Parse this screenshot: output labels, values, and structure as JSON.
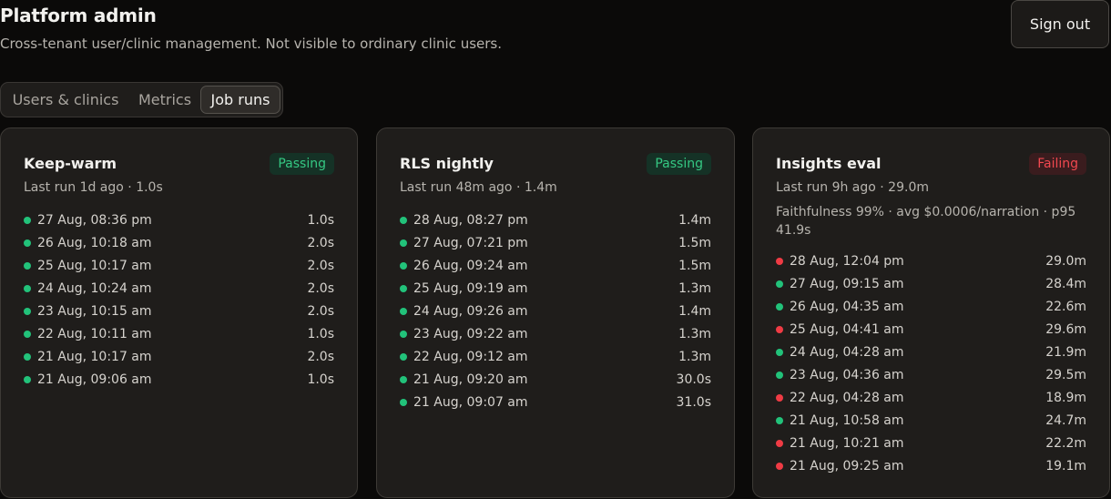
{
  "header": {
    "title": "Platform admin",
    "subtitle": "Cross-tenant user/clinic management. Not visible to ordinary clinic users.",
    "sign_out_label": "Sign out"
  },
  "tabs": [
    {
      "label": "Users & clinics",
      "active": false
    },
    {
      "label": "Metrics",
      "active": false
    },
    {
      "label": "Job runs",
      "active": true
    }
  ],
  "colors": {
    "pass_dot": "#22c27a",
    "fail_dot": "#ef3b44"
  },
  "jobs": [
    {
      "name": "Keep-warm",
      "status": "Passing",
      "status_kind": "pass",
      "last_run": "Last run 1d ago · 1.0s",
      "runs": [
        {
          "time": "27 Aug, 08:36 pm",
          "duration": "1.0s",
          "status": "pass"
        },
        {
          "time": "26 Aug, 10:18 am",
          "duration": "2.0s",
          "status": "pass"
        },
        {
          "time": "25 Aug, 10:17 am",
          "duration": "2.0s",
          "status": "pass"
        },
        {
          "time": "24 Aug, 10:24 am",
          "duration": "2.0s",
          "status": "pass"
        },
        {
          "time": "23 Aug, 10:15 am",
          "duration": "2.0s",
          "status": "pass"
        },
        {
          "time": "22 Aug, 10:11 am",
          "duration": "1.0s",
          "status": "pass"
        },
        {
          "time": "21 Aug, 10:17 am",
          "duration": "2.0s",
          "status": "pass"
        },
        {
          "time": "21 Aug, 09:06 am",
          "duration": "1.0s",
          "status": "pass"
        }
      ]
    },
    {
      "name": "RLS nightly",
      "status": "Passing",
      "status_kind": "pass",
      "last_run": "Last run 48m ago · 1.4m",
      "runs": [
        {
          "time": "28 Aug, 08:27 pm",
          "duration": "1.4m",
          "status": "pass"
        },
        {
          "time": "27 Aug, 07:21 pm",
          "duration": "1.5m",
          "status": "pass"
        },
        {
          "time": "26 Aug, 09:24 am",
          "duration": "1.5m",
          "status": "pass"
        },
        {
          "time": "25 Aug, 09:19 am",
          "duration": "1.3m",
          "status": "pass"
        },
        {
          "time": "24 Aug, 09:26 am",
          "duration": "1.4m",
          "status": "pass"
        },
        {
          "time": "23 Aug, 09:22 am",
          "duration": "1.3m",
          "status": "pass"
        },
        {
          "time": "22 Aug, 09:12 am",
          "duration": "1.3m",
          "status": "pass"
        },
        {
          "time": "21 Aug, 09:20 am",
          "duration": "30.0s",
          "status": "pass"
        },
        {
          "time": "21 Aug, 09:07 am",
          "duration": "31.0s",
          "status": "pass"
        }
      ]
    },
    {
      "name": "Insights eval",
      "status": "Failing",
      "status_kind": "fail",
      "last_run": "Last run 9h ago · 29.0m",
      "extra": "Faithfulness 99% · avg $0.0006/narration · p95 41.9s",
      "runs": [
        {
          "time": "28 Aug, 12:04 pm",
          "duration": "29.0m",
          "status": "fail"
        },
        {
          "time": "27 Aug, 09:15 am",
          "duration": "28.4m",
          "status": "pass"
        },
        {
          "time": "26 Aug, 04:35 am",
          "duration": "22.6m",
          "status": "pass"
        },
        {
          "time": "25 Aug, 04:41 am",
          "duration": "29.6m",
          "status": "fail"
        },
        {
          "time": "24 Aug, 04:28 am",
          "duration": "21.9m",
          "status": "pass"
        },
        {
          "time": "23 Aug, 04:36 am",
          "duration": "29.5m",
          "status": "pass"
        },
        {
          "time": "22 Aug, 04:28 am",
          "duration": "18.9m",
          "status": "fail"
        },
        {
          "time": "21 Aug, 10:58 am",
          "duration": "24.7m",
          "status": "pass"
        },
        {
          "time": "21 Aug, 10:21 am",
          "duration": "22.2m",
          "status": "fail"
        },
        {
          "time": "21 Aug, 09:25 am",
          "duration": "19.1m",
          "status": "fail"
        }
      ]
    }
  ]
}
